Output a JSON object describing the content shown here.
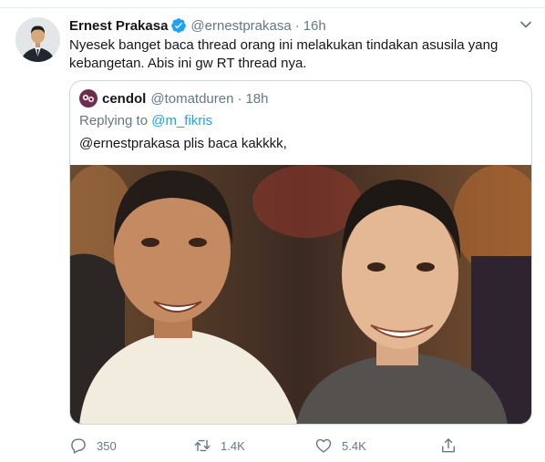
{
  "tweet": {
    "author_name": "Ernest Prakasa",
    "author_handle": "@ernestprakasa",
    "separator": "·",
    "time": "16h",
    "text": "Nyesek banget baca thread orang ini melakukan tindakan asusila yang kebangetan. Abis ini gw RT thread nya.",
    "verified": true
  },
  "quoted_tweet": {
    "author_name": "cendol",
    "author_handle": "@tomatduren",
    "separator": "·",
    "time": "18h",
    "replying_prefix": "Replying to ",
    "replying_to": "@m_fikris",
    "text": "@ernestprakasa plis baca kakkkk,"
  },
  "actions": {
    "replies": "350",
    "retweets": "1.4K",
    "likes": "5.4K"
  },
  "colors": {
    "accent": "#1da1f2",
    "secondary_text": "#657786",
    "border": "#ccd6dd"
  }
}
